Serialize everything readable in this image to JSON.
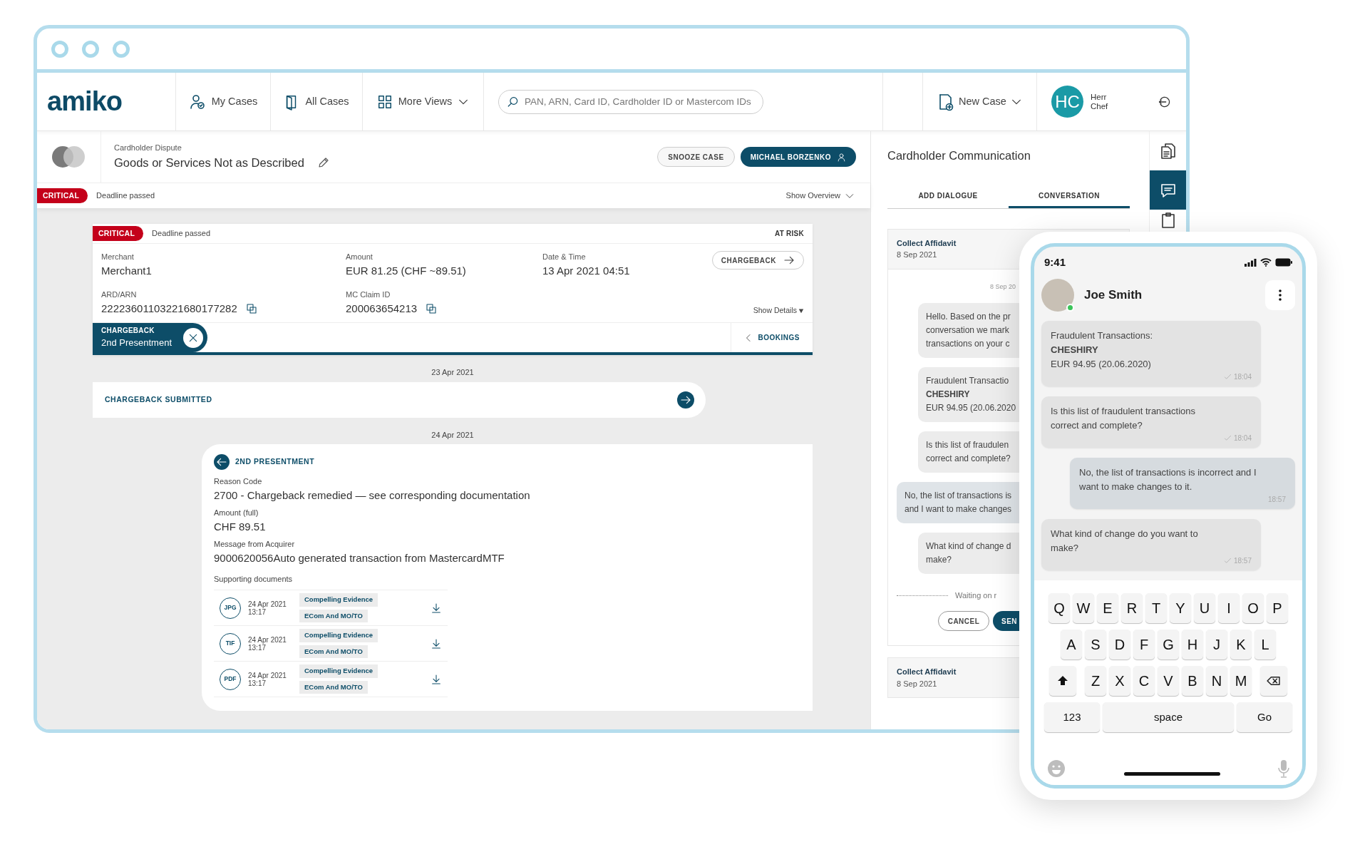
{
  "nav": {
    "logo": "amiko",
    "my_cases": "My Cases",
    "all_cases": "All Cases",
    "more_views": "More Views",
    "search_placeholder": "PAN, ARN, Card ID, Cardholder ID or Mastercom IDs",
    "new_case": "New Case",
    "user": {
      "initials": "HC",
      "name": "Herr Chef"
    }
  },
  "case_header": {
    "type_label": "Cardholder Dispute",
    "title": "Goods or Services Not as Described",
    "buttons": [
      {
        "label": "SNOOZE CASE",
        "kind": "outline"
      },
      {
        "label": "MICHAEL BORZENKO",
        "kind": "assignee"
      }
    ]
  },
  "status": {
    "tag": "CRITICAL",
    "text": "Deadline passed",
    "overview_link": "Show Overview"
  },
  "case_card": {
    "tag": "CRITICAL",
    "deadline": "Deadline passed",
    "risk": "AT RISK",
    "fields": [
      {
        "label": "Merchant",
        "value": "Merchant1",
        "copyable": false
      },
      {
        "label": "Amount",
        "value": "EUR 81.25 (CHF ~89.51)",
        "copyable": false
      },
      {
        "label": "Date & Time",
        "value": "13 Apr 2021 04:51",
        "copyable": false
      },
      {
        "label": "ARD/ARN",
        "value": "22223601103221680177282",
        "copyable": true
      },
      {
        "label": "MC Claim ID",
        "value": "200063654213",
        "copyable": true
      }
    ],
    "chargeback_button": "CHARGEBACK",
    "show_details": "Show Details",
    "stage": {
      "label": "CHARGEBACK",
      "value": "2nd Presentment"
    },
    "bookings": "BOOKINGS"
  },
  "timeline": [
    {
      "date": "23 Apr 2021",
      "kind": "event",
      "title": "CHARGEBACK SUBMITTED"
    },
    {
      "date": "24 Apr 2021",
      "kind": "detail",
      "title": "2ND PRESENTMENT",
      "fields": [
        {
          "label": "Reason Code",
          "value": "2700 - Chargeback remedied — see corresponding documentation"
        },
        {
          "label": "Amount (full)",
          "value": "CHF 89.51"
        },
        {
          "label": "Message from Acquirer",
          "value": "9000620056Auto generated transaction from MastercardMTF"
        }
      ],
      "documents_label": "Supporting documents",
      "documents": [
        {
          "type": "JPG",
          "date": "24 Apr 2021",
          "time": "13:17",
          "tags": [
            "Compelling Evidence",
            "ECom And MO/TO"
          ]
        },
        {
          "type": "TIF",
          "date": "24 Apr 2021",
          "time": "13:17",
          "tags": [
            "Compelling Evidence",
            "ECom And MO/TO"
          ]
        },
        {
          "type": "PDF",
          "date": "24 Apr 2021",
          "time": "13:17",
          "tags": [
            "Compelling Evidence",
            "ECom And MO/TO"
          ]
        }
      ]
    }
  ],
  "communication": {
    "title": "Cardholder Communication",
    "tabs": [
      {
        "label": "ADD DIALOGUE",
        "selected": false
      },
      {
        "label": "CONVERSATION",
        "selected": true
      }
    ],
    "threads": [
      {
        "title": "Collect Affidavit",
        "date": "8 Sep 2021",
        "messages_date": "8 Sep 20",
        "messages": [
          {
            "kind": "incoming",
            "text": "Hello. Based on the pr\nconversation we mark\ntransactions on your c"
          },
          {
            "kind": "incoming",
            "text": "Fraudulent Transactio\n**CHESHIRY**\nEUR 94.95 (20.06.2020"
          },
          {
            "kind": "incoming",
            "text": "Is this list of fraudulen\ncorrect and complete?"
          },
          {
            "kind": "outgoing",
            "text": "No, the list of transactions is\nand I want to make changes"
          },
          {
            "kind": "incoming",
            "text": "What kind of change d\nmake?"
          }
        ],
        "waiting": "Waiting on r",
        "buttons": [
          {
            "label": "CANCEL",
            "kind": "outline"
          },
          {
            "label": "SEN",
            "kind": "primary"
          }
        ]
      },
      {
        "title": "Collect Affidavit",
        "date": "8 Sep 2021"
      }
    ]
  },
  "side_tools": [
    {
      "selected": false
    },
    {
      "selected": true
    },
    {
      "selected": false
    }
  ],
  "phone": {
    "time": "9:41",
    "contact": {
      "name": "Joe Smith",
      "online": true
    },
    "messages": [
      {
        "kind": "incoming",
        "text": "Fraudulent Transactions:\n**CHESHIRY**\nEUR 94.95 (20.06.2020)",
        "time": "18:04",
        "delivered": true
      },
      {
        "kind": "incoming",
        "text": "Is this list of fraudulent transactions correct and complete?",
        "time": "18:04",
        "delivered": true
      },
      {
        "kind": "outgoing",
        "text": "No, the list of transactions is incorrect and I want to make changes to it.",
        "time": "18:57",
        "delivered": false
      },
      {
        "kind": "incoming",
        "text": "What kind of change do you want to make?",
        "time": "18:57",
        "delivered": true
      }
    ],
    "keyboard": [
      [
        {
          "kind": "char",
          "label": "Q"
        },
        {
          "kind": "char",
          "label": "W"
        },
        {
          "kind": "char",
          "label": "E"
        },
        {
          "kind": "char",
          "label": "R"
        },
        {
          "kind": "char",
          "label": "T"
        },
        {
          "kind": "char",
          "label": "Y"
        },
        {
          "kind": "char",
          "label": "U"
        },
        {
          "kind": "char",
          "label": "I"
        },
        {
          "kind": "char",
          "label": "O"
        },
        {
          "kind": "char",
          "label": "P"
        }
      ],
      [
        {
          "kind": "char",
          "label": "A"
        },
        {
          "kind": "char",
          "label": "S"
        },
        {
          "kind": "char",
          "label": "D"
        },
        {
          "kind": "char",
          "label": "F"
        },
        {
          "kind": "char",
          "label": "G"
        },
        {
          "kind": "char",
          "label": "H"
        },
        {
          "kind": "char",
          "label": "J"
        },
        {
          "kind": "char",
          "label": "K"
        },
        {
          "kind": "char",
          "label": "L"
        }
      ],
      [
        {
          "kind": "shift"
        },
        {
          "kind": "char",
          "label": "Z"
        },
        {
          "kind": "char",
          "label": "X"
        },
        {
          "kind": "char",
          "label": "C"
        },
        {
          "kind": "char",
          "label": "V"
        },
        {
          "kind": "char",
          "label": "B"
        },
        {
          "kind": "char",
          "label": "N"
        },
        {
          "kind": "char",
          "label": "M"
        },
        {
          "kind": "backspace"
        }
      ],
      [
        {
          "kind": "wide",
          "label": "123"
        },
        {
          "kind": "space",
          "label": "space"
        },
        {
          "kind": "wide",
          "label": "Go"
        }
      ]
    ]
  }
}
